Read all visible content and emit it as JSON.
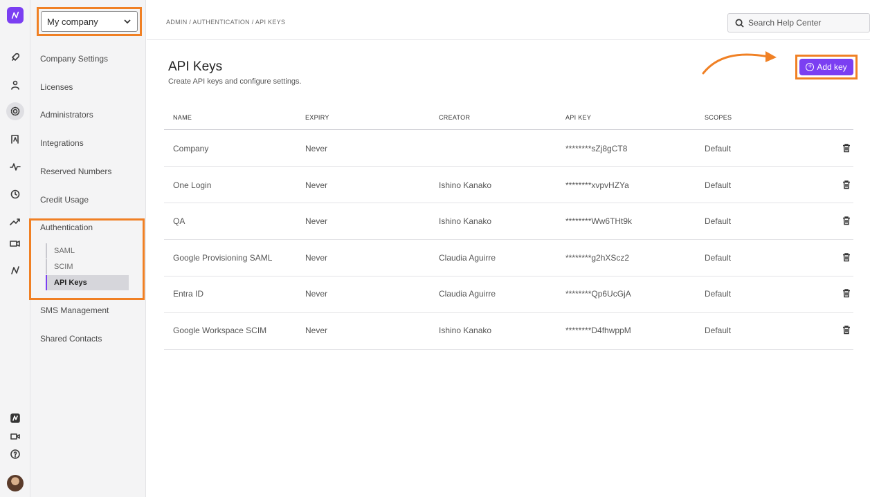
{
  "company_select": {
    "value": "My company"
  },
  "breadcrumb": "ADMIN / AUTHENTICATION / API KEYS",
  "search": {
    "placeholder": "Search Help Center"
  },
  "page": {
    "title": "API Keys",
    "subtitle": "Create API keys and configure settings.",
    "add_button": "Add key"
  },
  "rail_icons": [
    "rocket-icon",
    "user-icon",
    "gear-icon",
    "contacts-icon",
    "activity-icon",
    "history-icon",
    "trend-icon",
    "video-recorder-icon",
    "brand-icon",
    "app-logo-icon",
    "video-icon",
    "help-icon",
    "avatar"
  ],
  "nav": {
    "items": [
      "Company Settings",
      "Licenses",
      "Administrators",
      "Integrations",
      "Reserved Numbers",
      "Credit Usage",
      "Authentication",
      "SMS Management",
      "Shared Contacts"
    ],
    "auth_sub": [
      "SAML",
      "SCIM",
      "API Keys"
    ]
  },
  "table": {
    "headers": [
      "NAME",
      "EXPIRY",
      "CREATOR",
      "API KEY",
      "SCOPES"
    ],
    "rows": [
      {
        "name": "Company",
        "expiry": "Never",
        "creator": "",
        "key": "********sZj8gCT8",
        "scopes": "Default"
      },
      {
        "name": "One Login",
        "expiry": "Never",
        "creator": "Ishino Kanako",
        "key": "********xvpvHZYa",
        "scopes": "Default"
      },
      {
        "name": "QA",
        "expiry": "Never",
        "creator": "Ishino Kanako",
        "key": "********Ww6THt9k",
        "scopes": "Default"
      },
      {
        "name": "Google Provisioning SAML",
        "expiry": "Never",
        "creator": "Claudia Aguirre",
        "key": "********g2hXScz2",
        "scopes": "Default"
      },
      {
        "name": "Entra ID",
        "expiry": "Never",
        "creator": "Claudia Aguirre",
        "key": "********Qp6UcGjA",
        "scopes": "Default"
      },
      {
        "name": "Google Workspace SCIM",
        "expiry": "Never",
        "creator": "Ishino Kanako",
        "key": "********D4fhwppM",
        "scopes": "Default"
      }
    ]
  },
  "colors": {
    "accent": "#7b3ff2",
    "highlight": "#f08024"
  }
}
